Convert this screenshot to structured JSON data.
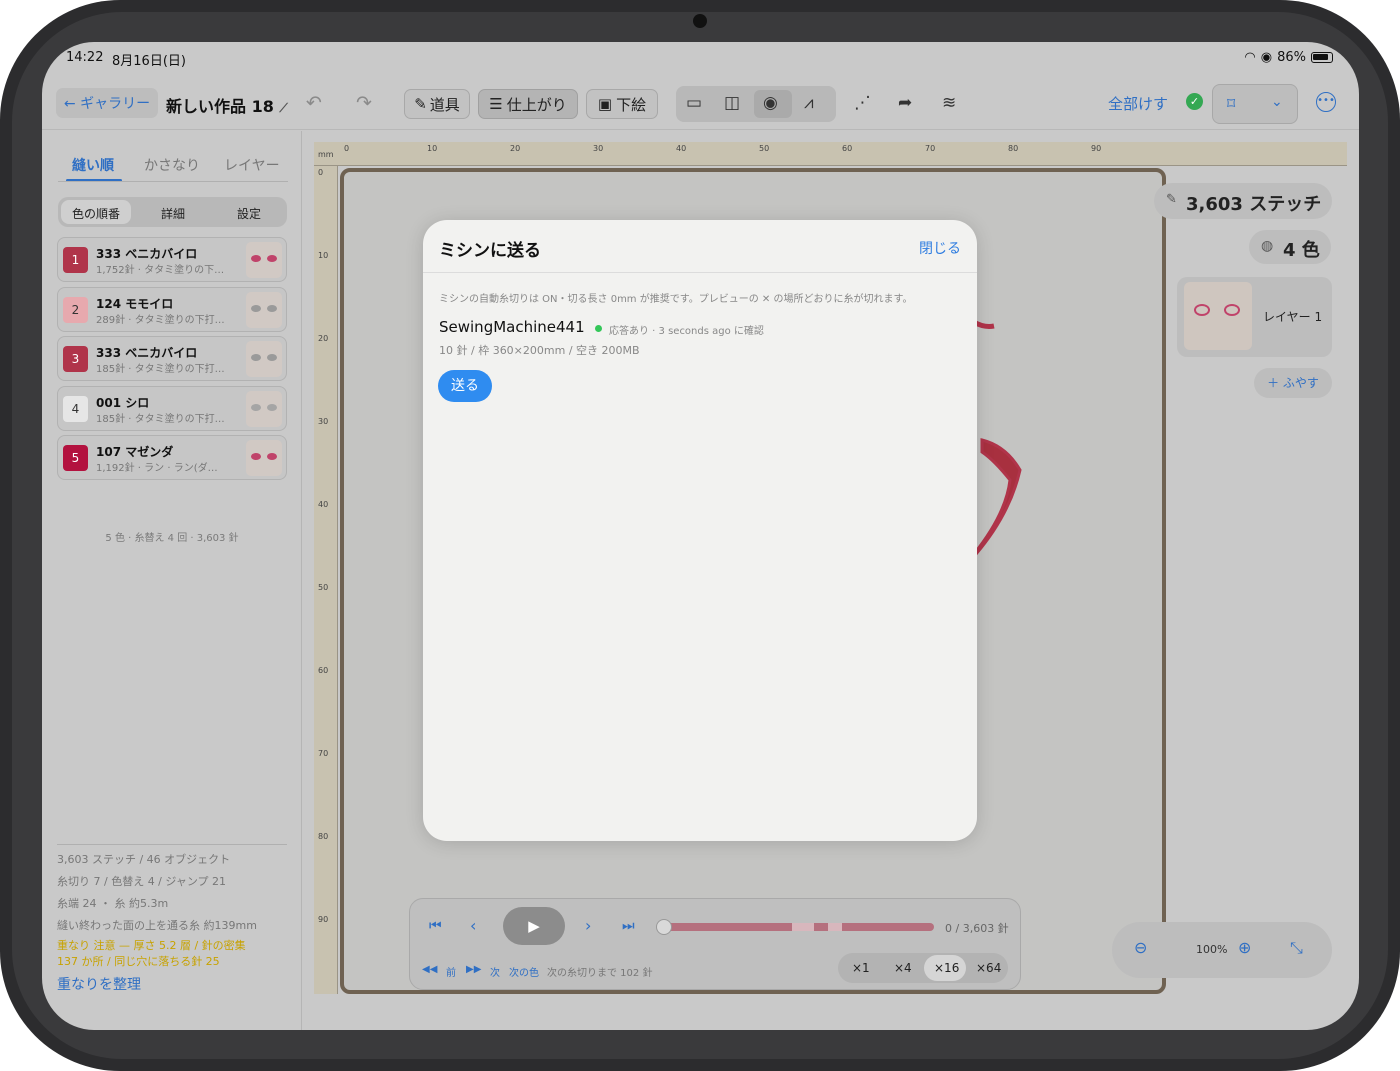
{
  "status_bar": {
    "time": "14:22",
    "date": "8月16日(日)",
    "battery": "86%"
  },
  "toolbar": {
    "back_label": "← ギャラリー",
    "title": "新しい作品 18",
    "tool_label": "道具",
    "finish_label": "仕上がり",
    "underdraw_label": "下絵",
    "clear_all_label": "全部けす"
  },
  "left_panel": {
    "tabs": [
      "縫い順",
      "かさなり",
      "レイヤー"
    ],
    "segments": [
      "色の順番",
      "詳細",
      "設定"
    ],
    "colors": [
      {
        "index": "1",
        "name": "333 ベニカバイロ",
        "detail": "1,752針 · タタミ塗りの下…",
        "color": "#b0344a",
        "eye": "#c0436a"
      },
      {
        "index": "2",
        "name": "124 モモイロ",
        "detail": "289針 · タタミ塗りの下打…",
        "color": "#e7a9ae",
        "eye": "#9a9a9a"
      },
      {
        "index": "3",
        "name": "333 ベニカバイロ",
        "detail": "185針 · タタミ塗りの下打…",
        "color": "#b0344a",
        "eye": "#9a9a9a"
      },
      {
        "index": "4",
        "name": "001 シロ",
        "detail": "185針 · タタミ塗りの下打…",
        "color": "#e6e6e6",
        "eye": "#a5a5a5"
      },
      {
        "index": "5",
        "name": "107 マゼンダ",
        "detail": "1,192針 · ラン · ラン(ダ…",
        "color": "#b3123f",
        "eye": "#c0436a"
      }
    ],
    "summary": "5 色 · 糸替え 4 回 · 3,603 針",
    "stats": [
      "3,603 ステッチ / 46 オブジェクト",
      "糸切り 7 / 色替え 4 / ジャンプ 21",
      "糸端 24 ・ 糸 約5.3m",
      "縫い終わった面の上を通る糸 約139mm"
    ],
    "warnings": [
      "重なり 注意 — 厚さ 5.2 層 / 針の密集",
      "137 か所 / 同じ穴に落ちる針 25"
    ],
    "organize_label": "重なりを整理"
  },
  "ruler": {
    "unit": "mm",
    "h_labels": [
      "0",
      "10",
      "20",
      "30",
      "40",
      "50",
      "60",
      "70",
      "80",
      "90"
    ],
    "v_labels": [
      "0",
      "10",
      "20",
      "30",
      "40",
      "50",
      "60",
      "70",
      "80",
      "90"
    ]
  },
  "right_panel": {
    "stitch_count": "3,603 ステッチ",
    "color_count": "4 色",
    "layer_name": "レイヤー 1",
    "add_layer_label": "＋ ふやす",
    "zoom_level": "100%"
  },
  "playback": {
    "counter": "0 / 3,603 針",
    "prev_label": "前",
    "next_label": "次",
    "next_color_label": "次の色",
    "next_trim_label": "次の糸切りまで 102 針",
    "speeds": [
      "×1",
      "×4",
      "×16",
      "×64"
    ],
    "active_speed": "×16",
    "progress": 0
  },
  "modal": {
    "title": "ミシンに送る",
    "close_label": "閉じる",
    "note": "ミシンの自動糸切りは ON・切る長さ 0mm が推奨です。プレビューの ✕ の場所どおりに糸が切れます。",
    "machine_name": "SewingMachine441",
    "machine_status": "応答あり · 3 seconds ago に確認",
    "machine_spec": "10 針 / 枠 360×200mm / 空き 200MB",
    "send_label": "送る"
  }
}
